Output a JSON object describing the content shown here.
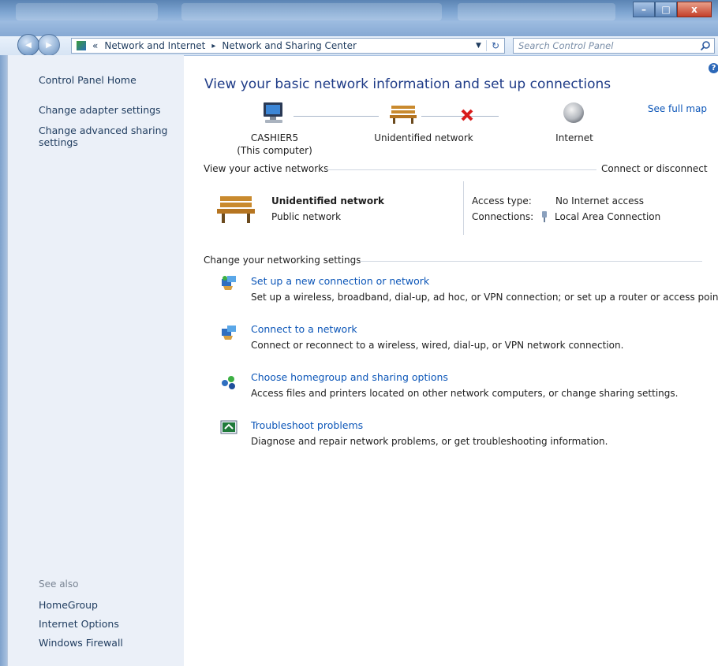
{
  "window": {
    "minimize_glyph": "–",
    "maximize_glyph": "□",
    "close_glyph": "x"
  },
  "address_bar": {
    "back_glyph": "◀",
    "forward_glyph": "▶",
    "overflow": "«",
    "crumbs": [
      "Network and Internet",
      "Network and Sharing Center"
    ],
    "separator": "▸",
    "search_placeholder": "Search Control Panel"
  },
  "sidebar": {
    "home": "Control Panel Home",
    "links": [
      "Change adapter settings",
      "Change advanced sharing settings"
    ],
    "see_also_title": "See also",
    "see_also": [
      "HomeGroup",
      "Internet Options",
      "Windows Firewall"
    ]
  },
  "main": {
    "help_glyph": "?",
    "title": "View your basic network information and set up connections",
    "see_full_map": "See full map",
    "map": {
      "computer_name": "CASHIER5",
      "computer_sub": "(This computer)",
      "network": "Unidentified network",
      "internet": "Internet"
    },
    "active_networks": {
      "title": "View your active networks",
      "connect_link": "Connect or disconnect",
      "network_name": "Unidentified network",
      "network_type": "Public network",
      "access_type_label": "Access type:",
      "access_type_value": "No Internet access",
      "connections_label": "Connections:",
      "connections_value": "Local Area Connection"
    },
    "settings": {
      "title": "Change your networking settings",
      "tasks": [
        {
          "label": "Set up a new connection or network",
          "desc": "Set up a wireless, broadband, dial-up, ad hoc, or VPN connection; or set up a router or access point."
        },
        {
          "label": "Connect to a network",
          "desc": "Connect or reconnect to a wireless, wired, dial-up, or VPN network connection."
        },
        {
          "label": "Choose homegroup and sharing options",
          "desc": "Access files and printers located on other network computers, or change sharing settings."
        },
        {
          "label": "Troubleshoot problems",
          "desc": "Diagnose and repair network problems, or get troubleshooting information."
        }
      ]
    }
  },
  "colors": {
    "link": "#0c56b8",
    "title": "#1e3b87",
    "sidebar_bg": "#ebf0f8",
    "error_x": "#d81b1b"
  }
}
